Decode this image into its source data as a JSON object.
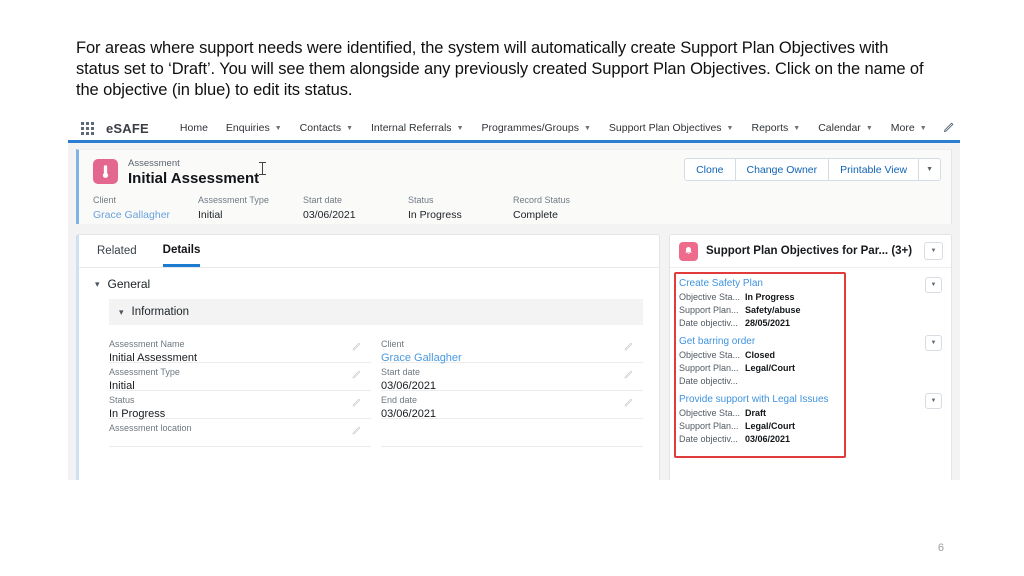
{
  "slide": {
    "paragraph": "For areas where support needs were identified, the system will automatically create Support Plan Objectives with status set to ‘Draft’. You will see them alongside any previously created Support Plan Objectives. Click on the name of the objective (in blue) to edit its status.",
    "page_number": "6",
    "highlight_color": "#e23b3b"
  },
  "nav": {
    "brand": "eSAFE",
    "items": [
      {
        "label": "Home",
        "has_dropdown": false
      },
      {
        "label": "Enquiries",
        "has_dropdown": true
      },
      {
        "label": "Contacts",
        "has_dropdown": true
      },
      {
        "label": "Internal Referrals",
        "has_dropdown": true
      },
      {
        "label": "Programmes/Groups",
        "has_dropdown": true
      },
      {
        "label": "Support Plan Objectives",
        "has_dropdown": true
      },
      {
        "label": "Reports",
        "has_dropdown": true
      },
      {
        "label": "Calendar",
        "has_dropdown": true
      },
      {
        "label": "More",
        "has_dropdown": true
      }
    ],
    "accent_color": "#2b7cd3"
  },
  "record": {
    "eyebrow": "Assessment",
    "title": "Initial Assessment",
    "icon": "thermometer-icon",
    "icon_color": "#e3678f",
    "actions": [
      {
        "label": "Clone"
      },
      {
        "label": "Change Owner"
      },
      {
        "label": "Printable View"
      }
    ],
    "fields": [
      {
        "label": "Client",
        "value": "Grace Gallagher",
        "is_link": true
      },
      {
        "label": "Assessment Type",
        "value": "Initial",
        "is_link": false
      },
      {
        "label": "Start date",
        "value": "03/06/2021",
        "is_link": false
      },
      {
        "label": "Status",
        "value": "In Progress",
        "is_link": false
      },
      {
        "label": "Record Status",
        "value": "Complete",
        "is_link": false
      }
    ]
  },
  "details": {
    "tabs": [
      {
        "label": "Related",
        "active": false
      },
      {
        "label": "Details",
        "active": true
      }
    ],
    "section": "General",
    "subsection": "Information",
    "left_fields": [
      {
        "label": "Assessment Name",
        "value": "Initial Assessment",
        "is_link": false
      },
      {
        "label": "Assessment Type",
        "value": "Initial",
        "is_link": false
      },
      {
        "label": "Status",
        "value": "In Progress",
        "is_link": false
      },
      {
        "label": "Assessment location",
        "value": "",
        "is_link": false
      }
    ],
    "right_fields": [
      {
        "label": "Client",
        "value": "Grace Gallagher",
        "is_link": true
      },
      {
        "label": "Start date",
        "value": "03/06/2021",
        "is_link": false
      },
      {
        "label": "End date",
        "value": "03/06/2021",
        "is_link": false
      },
      {
        "label": "",
        "value": "",
        "is_link": false
      }
    ]
  },
  "objectives_panel": {
    "title": "Support Plan Objectives for Par... (3+)",
    "icon": "bell-icon",
    "icon_color": "#ef6b8c",
    "cards": [
      {
        "name": "Create Safety Plan",
        "rows": [
          {
            "key": "Objective Sta...",
            "value": "In Progress"
          },
          {
            "key": "Support Plan...",
            "value": "Safety/abuse"
          },
          {
            "key": "Date objectiv...",
            "value": "28/05/2021"
          }
        ]
      },
      {
        "name": "Get barring order",
        "rows": [
          {
            "key": "Objective Sta...",
            "value": "Closed"
          },
          {
            "key": "Support Plan...",
            "value": "Legal/Court"
          },
          {
            "key": "Date objectiv...",
            "value": ""
          }
        ]
      },
      {
        "name": "Provide support with Legal Issues",
        "rows": [
          {
            "key": "Objective Sta...",
            "value": "Draft"
          },
          {
            "key": "Support Plan...",
            "value": "Legal/Court"
          },
          {
            "key": "Date objectiv...",
            "value": "03/06/2021"
          }
        ]
      }
    ]
  }
}
